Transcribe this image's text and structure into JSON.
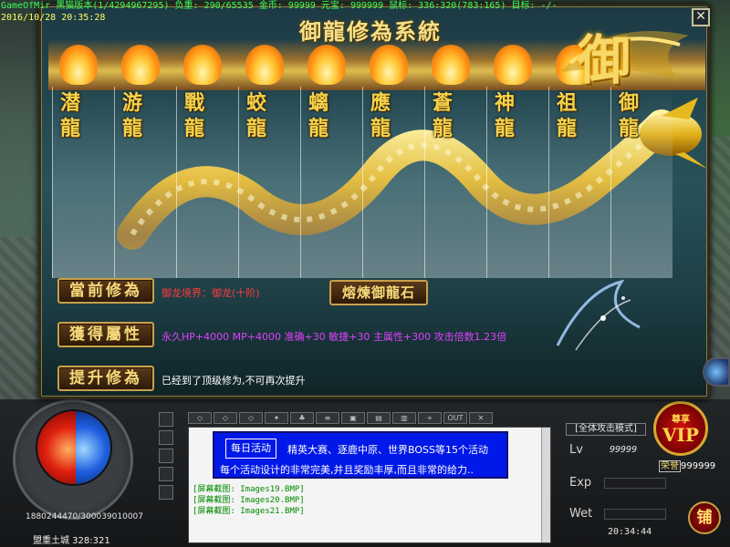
{
  "status_bar": {
    "line1": "GameOfMir 黑猫版本(1/4294967295) 负重: 290/65535 金币: 99999 元宝: 999999 鼠标: 336:320(783:165) 目标: -/-",
    "line2": "2016/10/28 20:35:28"
  },
  "dialog": {
    "title": "御龍修為系統",
    "close_label": "✕",
    "emblem_text": "御",
    "ranks": [
      "潜龍",
      "游龍",
      "戰龍",
      "蛟龍",
      "螭龍",
      "應龍",
      "蒼龍",
      "神龍",
      "祖龍",
      "御龍"
    ],
    "current": {
      "button": "當前修為",
      "text": "御龙境界：御龙(十阶)",
      "text_color": "#ff3b3b"
    },
    "smelt_button": "熔煉御龍石",
    "attributes": {
      "button": "獲得屬性",
      "text": "永久HP+4000 MP+4000 准确+30 敏捷+30 主属性+300 攻击倍数1.23倍",
      "text_color": "#e040ff"
    },
    "upgrade": {
      "button": "提升修為",
      "text": "已经到了顶级修为,不可再次提升",
      "text_color": "#ffffff"
    }
  },
  "hud": {
    "hp_mp": "1880244470/300039010007",
    "location": "盟重土城 328:321",
    "chat_tabs": [
      "◇",
      "◇",
      "◇",
      "✦",
      "♣",
      "≡",
      "▣",
      "▤",
      "▥",
      "+",
      "OUT",
      "✕"
    ],
    "event": {
      "tag": "每日活动",
      "line1": "精英大赛、逐鹿中原、世界BOSS等15个活动",
      "line2": "每个活动设计的非常完美,并且奖励丰厚,而且非常的给力.."
    },
    "log_lines": [
      "[屏幕截图: Images19.BMP]",
      "[屏幕截图: Images20.BMP]",
      "[屏幕截图: Images21.BMP]"
    ],
    "attack_mode": "[全体攻击模式]",
    "vip_top": "尊享",
    "vip_main": "VIP",
    "honor_label": "荣誉",
    "honor_value": "999999",
    "lv_label": "Lv",
    "lv_value": "99999",
    "exp_label": "Exp",
    "wet_label": "Wet",
    "clock": "20:34:44",
    "shop_label": "铺"
  },
  "colors": {
    "status_green": "#3cff5a",
    "gold": "#f5d24a",
    "chat_banner": "#0018e8",
    "log_green": "#008a00"
  }
}
